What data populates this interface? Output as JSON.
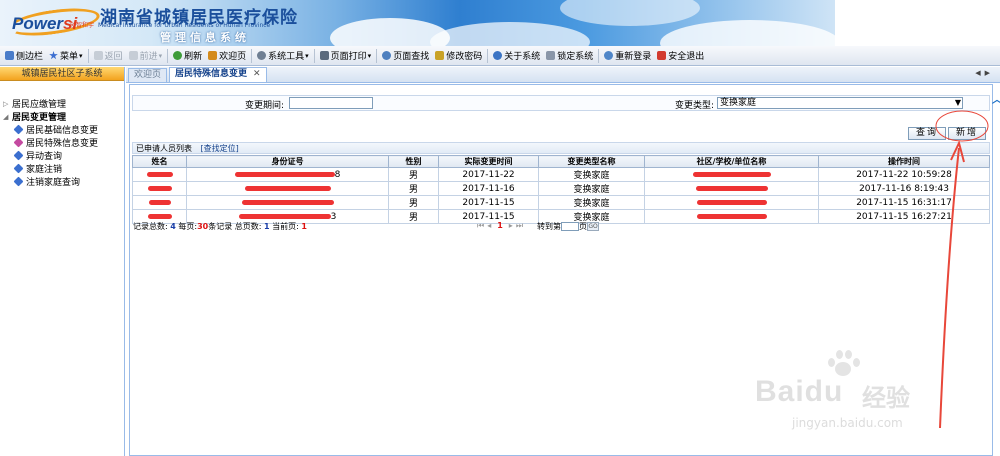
{
  "header": {
    "brand": "Power",
    "brand_accent": "si",
    "brand_cn": "创智和宇",
    "title": "湖南省城镇居民医疗保险",
    "title_en": "Medical Insurance for Urban Residents of Hunan Province",
    "subtitle": "管理信息系统"
  },
  "toolbar": {
    "items": [
      {
        "label": "侧边栏",
        "icon": "sidebar-icon",
        "enabled": true
      },
      {
        "label": "菜单",
        "icon": "star-icon",
        "enabled": true,
        "dropdown": true
      },
      {
        "label": "返回",
        "icon": "back-arrow-icon",
        "enabled": false
      },
      {
        "label": "前进",
        "icon": "forward-arrow-icon",
        "enabled": false,
        "dropdown": true
      },
      {
        "label": "刷新",
        "icon": "refresh-icon",
        "enabled": true
      },
      {
        "label": "欢迎页",
        "icon": "home-icon",
        "enabled": true
      },
      {
        "label": "系统工具",
        "icon": "gear-icon",
        "enabled": true,
        "dropdown": true
      },
      {
        "label": "页面打印",
        "icon": "printer-icon",
        "enabled": true,
        "dropdown": true
      },
      {
        "label": "页面查找",
        "icon": "search-icon",
        "enabled": true
      },
      {
        "label": "修改密码",
        "icon": "key-icon",
        "enabled": true
      },
      {
        "label": "关于系统",
        "icon": "help-icon",
        "enabled": true
      },
      {
        "label": "锁定系统",
        "icon": "lock-icon",
        "enabled": true
      },
      {
        "label": "重新登录",
        "icon": "user-icon",
        "enabled": true
      },
      {
        "label": "安全退出",
        "icon": "close-icon",
        "enabled": true
      }
    ]
  },
  "sidebar": {
    "title": "城镇居民社区子系统",
    "groups": [
      {
        "label": "居民应缴管理",
        "expanded": false
      },
      {
        "label": "居民变更管理",
        "expanded": true
      }
    ],
    "leaves": [
      {
        "label": "居民基础信息变更"
      },
      {
        "label": "居民特殊信息变更"
      },
      {
        "label": "异动查询"
      },
      {
        "label": "家庭注销"
      },
      {
        "label": "注销家庭查询"
      }
    ]
  },
  "tabs": [
    {
      "label": "欢迎页",
      "active": false
    },
    {
      "label": "居民特殊信息变更",
      "active": true,
      "closable": true
    }
  ],
  "form": {
    "change_date_label": "变更期间:",
    "change_date_value": "",
    "change_type_label": "变更类型:",
    "change_type_value": "变换家庭"
  },
  "buttons": {
    "query": "查询",
    "add": "新增"
  },
  "list": {
    "title": "已申请人员列表",
    "locate": "[查找定位]",
    "columns": [
      "姓名",
      "身份证号",
      "性别",
      "实际变更时间",
      "变更类型名称",
      "社区/学校/单位名称",
      "操作时间"
    ],
    "rows": [
      {
        "id_tail": "8",
        "gender": "男",
        "change_date": "2017-11-22",
        "type": "变换家庭",
        "op_time": "2017-11-22 10:59:28"
      },
      {
        "id_tail": "",
        "gender": "男",
        "change_date": "2017-11-16",
        "type": "变换家庭",
        "op_time": "2017-11-16 8:19:43"
      },
      {
        "id_tail": "",
        "gender": "男",
        "change_date": "2017-11-15",
        "type": "变换家庭",
        "op_time": "2017-11-15 16:31:17"
      },
      {
        "id_tail": "3",
        "gender": "男",
        "change_date": "2017-11-15",
        "type": "变换家庭",
        "op_time": "2017-11-15 16:27:21"
      }
    ]
  },
  "pager": {
    "total_label": "记录总数:",
    "total": "4",
    "per_page_label": "每页:",
    "per_page": "30",
    "per_page_unit": "条记录",
    "pages_label": "总页数:",
    "pages": "1",
    "current_label": "当前页:",
    "current": "1",
    "page_num": "1",
    "goto_label": "转到第",
    "goto_unit": "页",
    "go": "GO"
  },
  "watermark": {
    "text": "Baidu",
    "cn": "经验",
    "url": "jingyan.baidu.com"
  },
  "colors": {
    "accent": "#15428b",
    "header_orange": "#f3a31e",
    "redaction": "#e33333",
    "annotation": "#e8473a"
  }
}
